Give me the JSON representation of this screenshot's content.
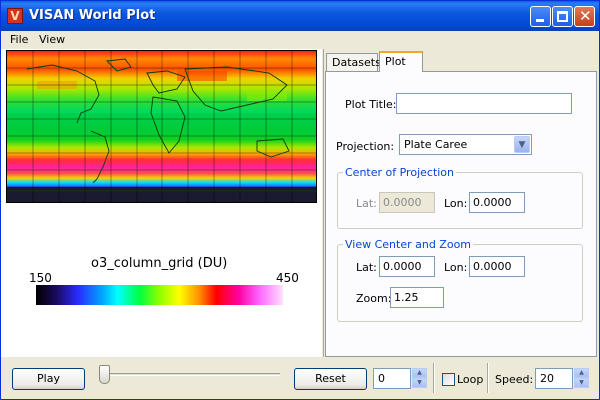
{
  "window": {
    "title": "VISAN World Plot",
    "app_icon_letter": "V"
  },
  "menu": {
    "items": [
      {
        "label": "File"
      },
      {
        "label": "View"
      }
    ]
  },
  "plot": {
    "colorbar_title": "o3_column_grid (DU)",
    "colorbar_min": "150",
    "colorbar_max": "450",
    "colormap_colors": [
      "#000000",
      "#1a0a5a",
      "#2a2aff",
      "#00a8ff",
      "#00ffff",
      "#00ff40",
      "#90ff00",
      "#ffff00",
      "#ff9000",
      "#ff0000",
      "#ff00a0",
      "#ff60ff",
      "#ffe0ff"
    ]
  },
  "tabs": [
    {
      "label": "Datasets",
      "active": false
    },
    {
      "label": "Plot",
      "active": true
    }
  ],
  "plot_panel": {
    "plot_title_label": "Plot Title:",
    "plot_title_value": "",
    "projection_label": "Projection:",
    "projection_value": "Plate Caree",
    "center_group": {
      "title": "Center of Projection",
      "lat_label": "Lat:",
      "lat_value": "0.0000",
      "lon_label": "Lon:",
      "lon_value": "0.0000"
    },
    "view_group": {
      "title": "View Center and Zoom",
      "lat_label": "Lat:",
      "lat_value": "0.0000",
      "lon_label": "Lon:",
      "lon_value": "0.0000",
      "zoom_label": "Zoom:",
      "zoom_value": "1.25"
    }
  },
  "toolbar": {
    "play_label": "Play",
    "reset_label": "Reset",
    "frame_value": "0",
    "loop_label": "Loop",
    "loop_checked": false,
    "speed_label": "Speed:",
    "speed_value": "20",
    "slider_position": 0
  },
  "colors": {
    "titlebar": "#0a58df",
    "accent_tab": "#f5a623",
    "group_title": "#0046d5"
  }
}
